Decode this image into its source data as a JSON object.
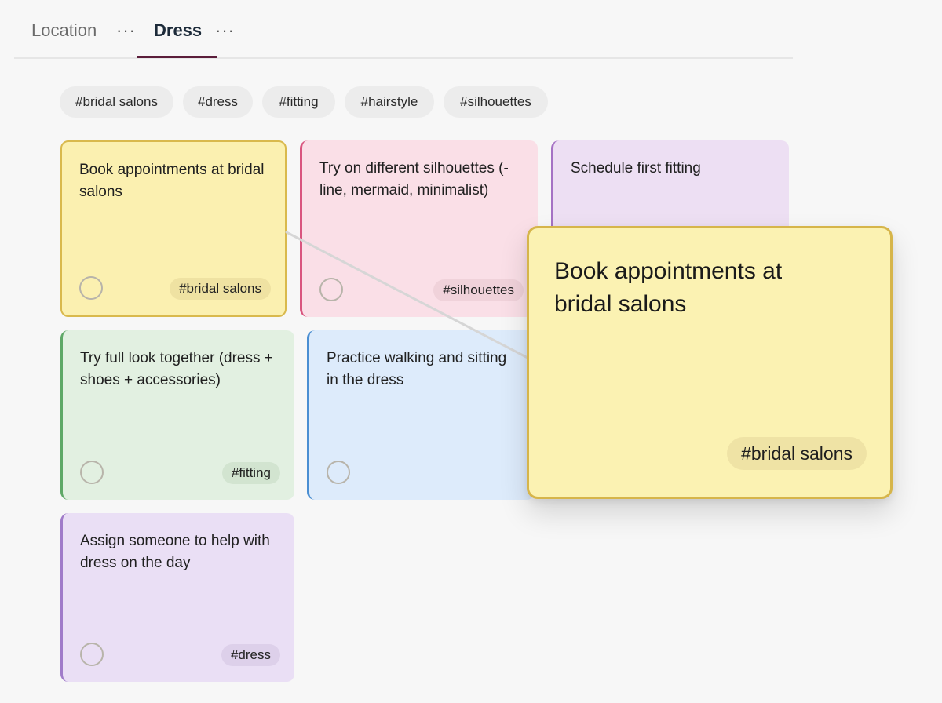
{
  "tabs": [
    {
      "label": "Location",
      "more": "···"
    },
    {
      "label": "Dress",
      "more": "···"
    }
  ],
  "active_tab": "Dress",
  "filters": [
    "#bridal salons",
    "#dress",
    "#fitting",
    "#hairstyle",
    "#silhouettes"
  ],
  "cards": [
    {
      "title": "Book appointments at bridal salons",
      "tag": "#bridal salons",
      "color": "#fbf0b0"
    },
    {
      "title": "Try on different silhouettes (-line, mermaid, minimalist)",
      "tag": "#silhouettes",
      "color": "#fadfe7"
    },
    {
      "title": "Schedule first fitting",
      "tag": "",
      "color": "#eddff3"
    },
    {
      "title": "Try full look together (dress + shoes + accessories)",
      "tag": "#fitting",
      "color": "#e2f0e1"
    },
    {
      "title": "Practice walking and sitting in the dress",
      "tag": "",
      "color": "#ddebfb"
    },
    {
      "title": "Assign someone to help with dress on the day",
      "tag": "#dress",
      "color": "#eadff5"
    }
  ],
  "dragging_card": {
    "title": "Book appointments at bridal salons",
    "tag": "#bridal salons"
  },
  "colors": {
    "accent": "#5b1d3a",
    "yellow_border": "#d9b94d"
  }
}
